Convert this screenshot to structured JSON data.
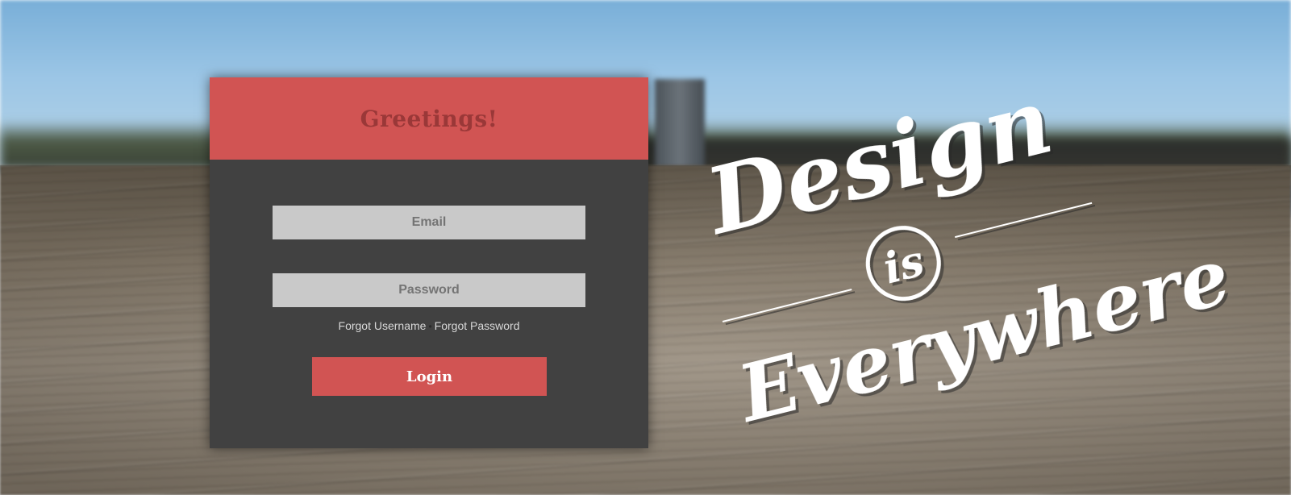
{
  "login_card": {
    "greeting": "Greetings!",
    "email": {
      "placeholder": "Email",
      "value": ""
    },
    "password": {
      "placeholder": "Password",
      "value": ""
    },
    "forgot_username": "Forgot Username",
    "separator": "•",
    "forgot_password": "Forgot Password",
    "login_label": "Login"
  },
  "artwork": {
    "word_1": "Design",
    "word_2": "is",
    "word_3": "Everywhere"
  },
  "colors": {
    "accent": "#d15453",
    "card_body": "#414141",
    "input_bg": "#c9c9c9",
    "greeting_text": "#9a3838"
  },
  "icons": {
    "background": "blurred-boardwalk-photo"
  }
}
